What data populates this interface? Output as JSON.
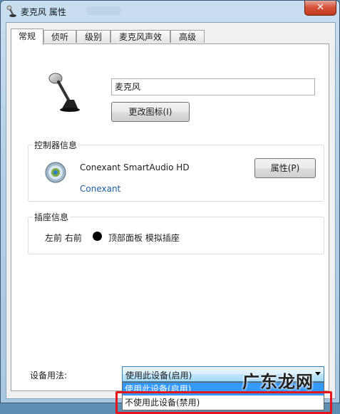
{
  "window": {
    "title": "麦克风 属性",
    "close": "✕"
  },
  "tabs": [
    {
      "label": "常规",
      "active": true
    },
    {
      "label": "侦听",
      "active": false
    },
    {
      "label": "级别",
      "active": false
    },
    {
      "label": "麦克风声效",
      "active": false
    },
    {
      "label": "高级",
      "active": false
    }
  ],
  "general": {
    "device_name": "麦克风",
    "change_icon_button": "更改图标(I)"
  },
  "controller": {
    "group_label": "控制器信息",
    "device": "Conexant SmartAudio HD",
    "vendor_link": "Conexant",
    "properties_button": "属性(P)"
  },
  "jack": {
    "group_label": "插座信息",
    "position": "左前 右前",
    "description": "顶部面板 模拟插座",
    "color": "#000000"
  },
  "usage": {
    "label": "设备用法:",
    "selected": "使用此设备(启用)",
    "options": [
      "使用此设备(启用)",
      "不使用此设备(禁用)"
    ]
  },
  "watermark": "广东龙网",
  "colors": {
    "highlight": "#e8141c",
    "selection": "#3399ff"
  }
}
